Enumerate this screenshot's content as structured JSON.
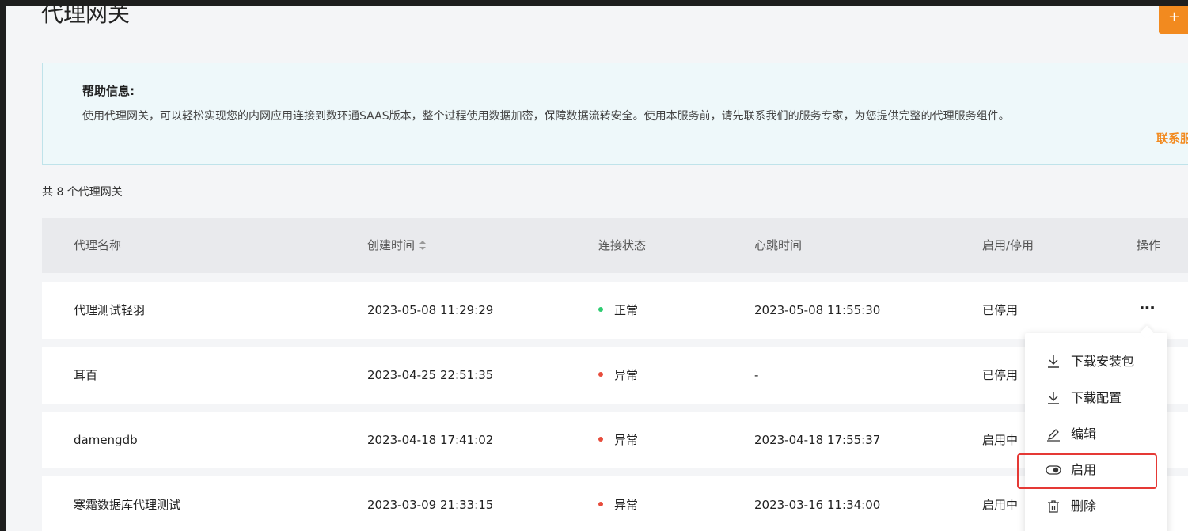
{
  "page": {
    "title": "代理网关",
    "add_button_label": "+"
  },
  "help": {
    "title": "帮助信息:",
    "body": "使用代理网关，可以轻松实现您的内网应用连接到数环通SAAS版本，整个过程使用数据加密，保障数据流转安全。使用本服务前，请先联系我们的服务专家，为您提供完整的代理服务组件。",
    "contact_link": "联系服"
  },
  "summary": {
    "count_text": "共 8 个代理网关"
  },
  "table": {
    "columns": [
      "代理名称",
      "创建时间",
      "连接状态",
      "心跳时间",
      "启用/停用",
      "操作"
    ],
    "rows": [
      {
        "name": "代理测试轻羽",
        "created": "2023-05-08 11:29:29",
        "status": "正常",
        "status_color": "#2ecc71",
        "heartbeat": "2023-05-08 11:55:30",
        "enabled": "已停用",
        "action": "···"
      },
      {
        "name": "耳百",
        "created": "2023-04-25 22:51:35",
        "status": "异常",
        "status_color": "#e74c3c",
        "heartbeat": "-",
        "enabled": "已停用"
      },
      {
        "name": "damengdb",
        "created": "2023-04-18 17:41:02",
        "status": "异常",
        "status_color": "#e74c3c",
        "heartbeat": "2023-04-18 17:55:37",
        "enabled": "启用中"
      },
      {
        "name": "寒霜数据库代理测试",
        "created": "2023-03-09 21:33:15",
        "status": "异常",
        "status_color": "#e74c3c",
        "heartbeat": "2023-03-16 11:34:00",
        "enabled": "启用中"
      }
    ]
  },
  "dropdown": {
    "items": [
      {
        "label": "下载安装包",
        "icon": "download-icon"
      },
      {
        "label": "下载配置",
        "icon": "download-icon"
      },
      {
        "label": "编辑",
        "icon": "pencil-icon"
      },
      {
        "label": "启用",
        "icon": "toggle-icon"
      },
      {
        "label": "删除",
        "icon": "trash-icon"
      }
    ]
  },
  "colors": {
    "accent": "#f28a1f",
    "highlight": "#e53935"
  }
}
